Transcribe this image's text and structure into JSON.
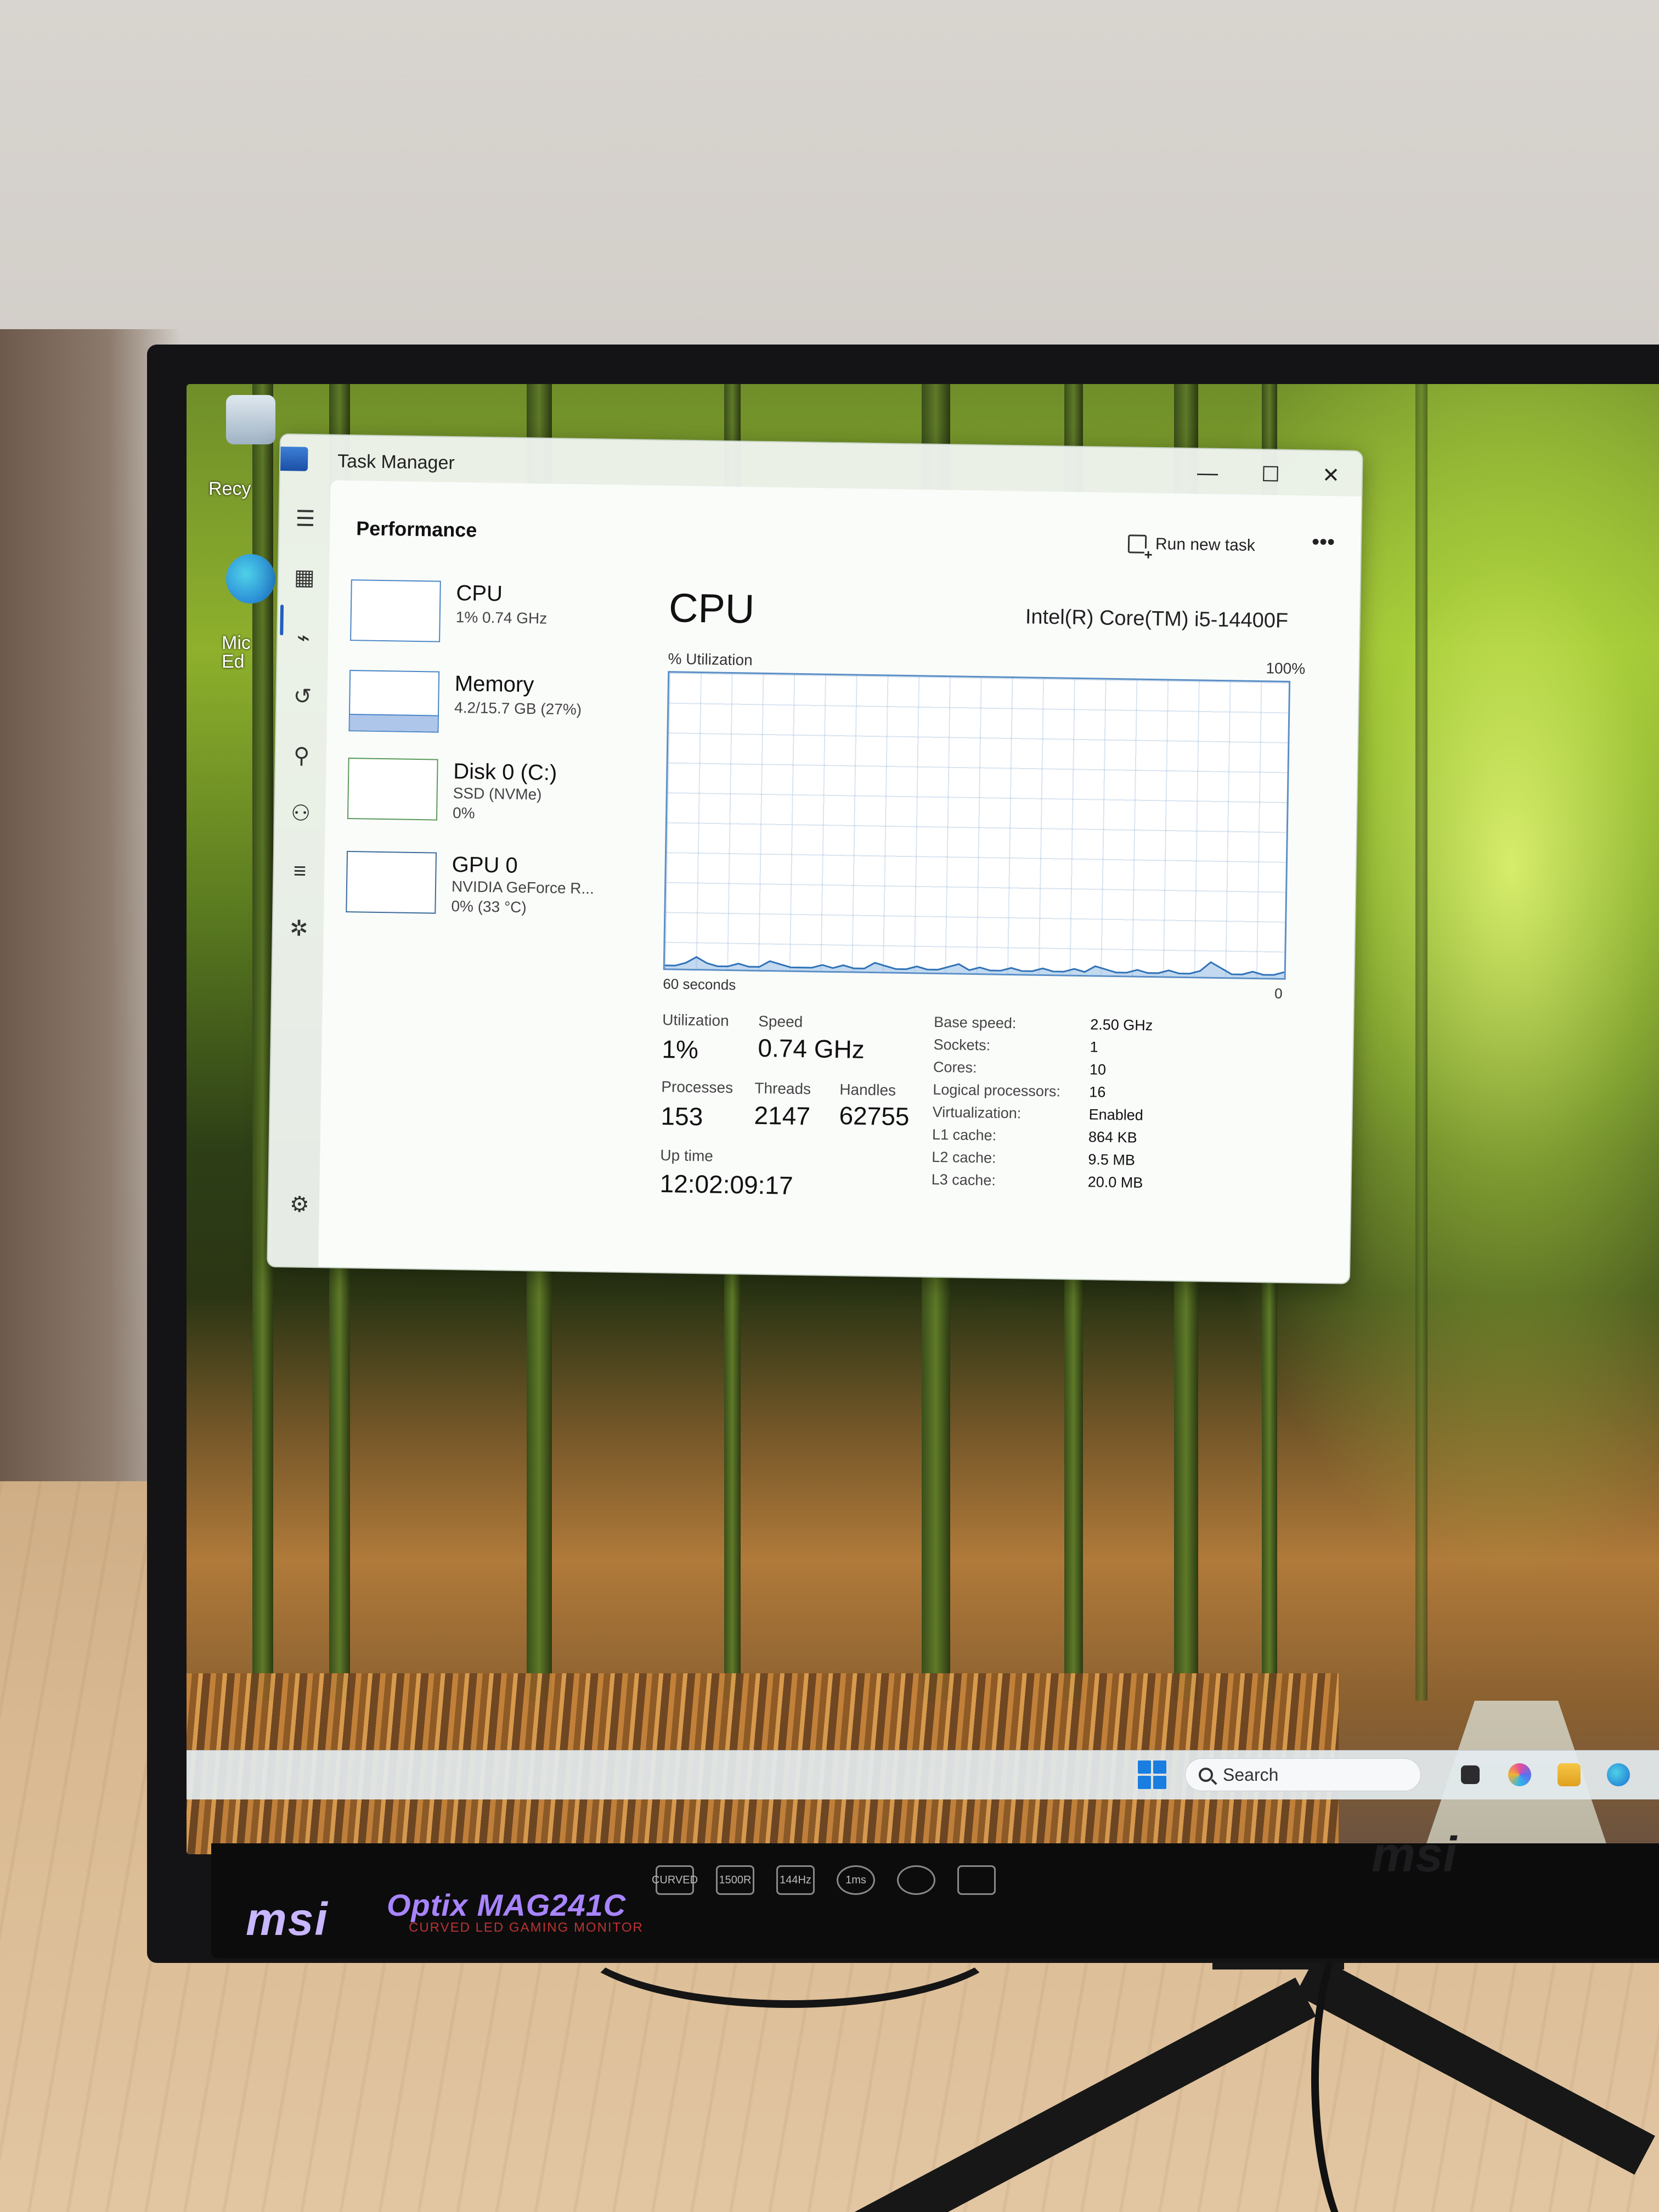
{
  "desktop": {
    "icons": [
      {
        "label": "Recy",
        "icon": "recycle-bin-icon"
      },
      {
        "label": "Mic\nEd",
        "icon": "edge-icon"
      }
    ],
    "taskbar": {
      "search_placeholder": "Search",
      "icons": [
        "windows-start-icon",
        "search-icon",
        "task-view-icon",
        "copilot-icon",
        "file-explorer-icon",
        "edge-icon"
      ]
    }
  },
  "task_manager": {
    "title": "Task Manager",
    "window_controls": {
      "minimize": "—",
      "maximize": "☐",
      "close": "✕"
    },
    "page_title": "Performance",
    "run_new_task": "Run new task",
    "more": "•••",
    "nav_icons": [
      "hamburger-menu-icon",
      "processes-icon",
      "performance-icon",
      "app-history-icon",
      "startup-apps-icon",
      "users-icon",
      "details-icon",
      "services-icon",
      "settings-icon"
    ],
    "resources": [
      {
        "name": "CPU",
        "sub1": "1% 0.74 GHz",
        "sub2": ""
      },
      {
        "name": "Memory",
        "sub1": "4.2/15.7 GB (27%)",
        "sub2": ""
      },
      {
        "name": "Disk 0 (C:)",
        "sub1": "SSD (NVMe)",
        "sub2": "0%"
      },
      {
        "name": "GPU 0",
        "sub1": "NVIDIA GeForce R...",
        "sub2": "0% (33 °C)"
      }
    ],
    "cpu": {
      "heading": "CPU",
      "model": "Intel(R) Core(TM) i5-14400F",
      "graph_label": "% Utilization",
      "graph_max": "100%",
      "graph_time": "60 seconds",
      "graph_min": "0",
      "utilization_label": "Utilization",
      "utilization": "1%",
      "speed_label": "Speed",
      "speed": "0.74 GHz",
      "processes_label": "Processes",
      "processes": "153",
      "threads_label": "Threads",
      "threads": "2147",
      "handles_label": "Handles",
      "handles": "62755",
      "uptime_label": "Up time",
      "uptime": "12:02:09:17",
      "specs": [
        {
          "label": "Base speed:",
          "value": "2.50 GHz"
        },
        {
          "label": "Sockets:",
          "value": "1"
        },
        {
          "label": "Cores:",
          "value": "10"
        },
        {
          "label": "Logical processors:",
          "value": "16"
        },
        {
          "label": "Virtualization:",
          "value": "Enabled"
        },
        {
          "label": "L1 cache:",
          "value": "864 KB"
        },
        {
          "label": "L2 cache:",
          "value": "9.5 MB"
        },
        {
          "label": "L3 cache:",
          "value": "20.0 MB"
        }
      ],
      "utilization_history": [
        1,
        1,
        2,
        4,
        2,
        1,
        1,
        2,
        1,
        1,
        3,
        2,
        1,
        1,
        1,
        2,
        1,
        2,
        1,
        1,
        3,
        2,
        1,
        1,
        2,
        1,
        1,
        2,
        3,
        1,
        2,
        1,
        1,
        2,
        1,
        1,
        2,
        1,
        1,
        2,
        1,
        3,
        2,
        1,
        1,
        2,
        1,
        1,
        2,
        1,
        1,
        2,
        5,
        3,
        1,
        1,
        2,
        1,
        1,
        2
      ]
    }
  },
  "monitor": {
    "brand": "msi",
    "model": "Optix MAG241C",
    "tagline": "CURVED LED GAMING MONITOR",
    "features": [
      "CURVED",
      "1500R",
      "144Hz",
      "1ms",
      "",
      ""
    ],
    "corner_brand": "msi"
  }
}
